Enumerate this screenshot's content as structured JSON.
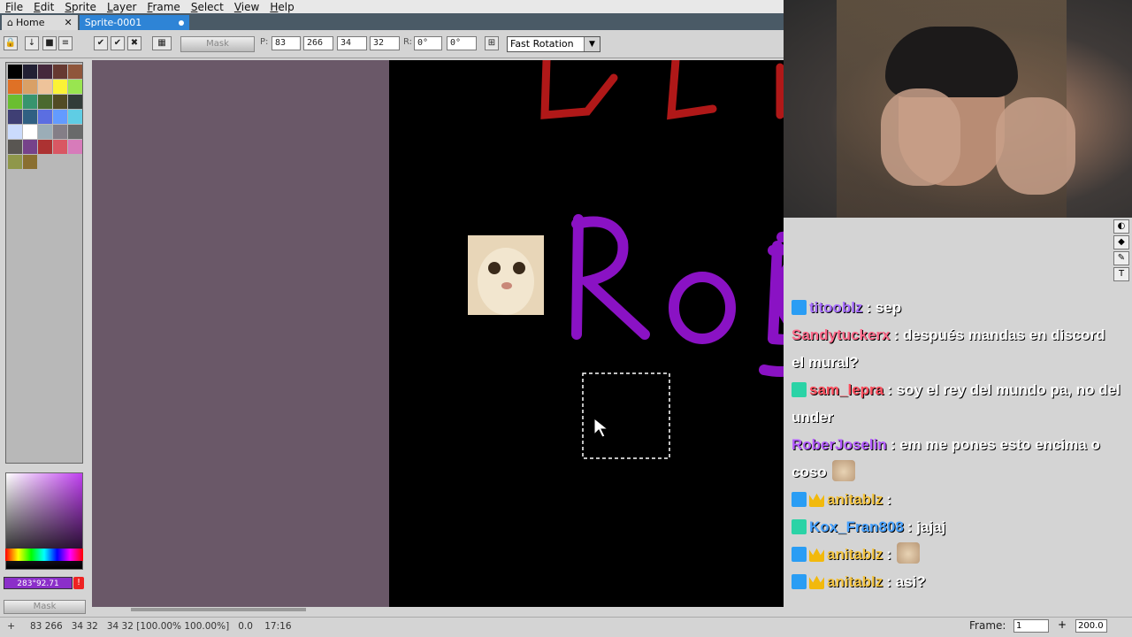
{
  "menu": [
    "File",
    "Edit",
    "Sprite",
    "Layer",
    "Frame",
    "Select",
    "View",
    "Help"
  ],
  "tabs": [
    {
      "label": "Home",
      "close": "✕"
    },
    {
      "label": "Sprite-0001"
    }
  ],
  "toolbar": {
    "mask_label": "Mask",
    "pos_label": "P:",
    "x": "83",
    "y": "266",
    "w": "34",
    "h": "32",
    "rot_label": "R:",
    "rot1": "0°",
    "rot2": "0°",
    "rotation_algorithm": "Fast Rotation"
  },
  "left_panel": {
    "color_value": "283°92.71",
    "warn": "!",
    "mask_label": "Mask",
    "palette": [
      "#000000",
      "#222034",
      "#45283c",
      "#663931",
      "#8f563b",
      "#df7126",
      "#d9a066",
      "#eec39a",
      "#fbf236",
      "#99e550",
      "#6abe30",
      "#37946e",
      "#4b692f",
      "#524b24",
      "#323c39",
      "#3f3f74",
      "#306082",
      "#5b6ee1",
      "#639bff",
      "#5fcde4",
      "#cbdbfc",
      "#ffffff",
      "#9badb7",
      "#847e87",
      "#696a6a",
      "#595652",
      "#76428a",
      "#ac3232",
      "#d95763",
      "#d77bba",
      "#8f974a",
      "#8a6f30"
    ]
  },
  "canvas": {
    "purple_text": "RoBERJo",
    "red_text": "DEL"
  },
  "chat": [
    {
      "badges": [
        "blue"
      ],
      "user": "titooblz",
      "user_color": "#a970ff",
      "text": ": sep"
    },
    {
      "badges": [],
      "user": "Sandytuckerx",
      "user_color": "#ff6b8b",
      "text": ": después mandas en discord el mural?"
    },
    {
      "badges": [
        "teal"
      ],
      "user": "sam_lepra",
      "user_color": "#ff4f5e",
      "text": ": soy el rey del mundo pa, no del under"
    },
    {
      "badges": [],
      "user": "RoberJoselin",
      "user_color": "#b45cff",
      "text": ": em me pones esto encima o coso",
      "emote": true
    },
    {
      "badges": [
        "blue",
        "crown"
      ],
      "user": "anitablz",
      "user_color": "#f5c542",
      "text": ":"
    },
    {
      "badges": [
        "teal"
      ],
      "user": "Kox_Fran808",
      "user_color": "#4aa3ff",
      "text": ": jajaj"
    },
    {
      "badges": [
        "blue",
        "crown"
      ],
      "user": "anitablz",
      "user_color": "#f5c542",
      "text": ":",
      "emote": true
    },
    {
      "badges": [
        "blue",
        "crown"
      ],
      "user": "anitablz",
      "user_color": "#f5c542",
      "text": ": asi?"
    }
  ],
  "status": {
    "text": "83 266   34 32   34 32 [100.00% 100.00%]   0.0    17:16",
    "frame_label": "Frame:",
    "frame_value": "1",
    "zoom": "200.0"
  }
}
